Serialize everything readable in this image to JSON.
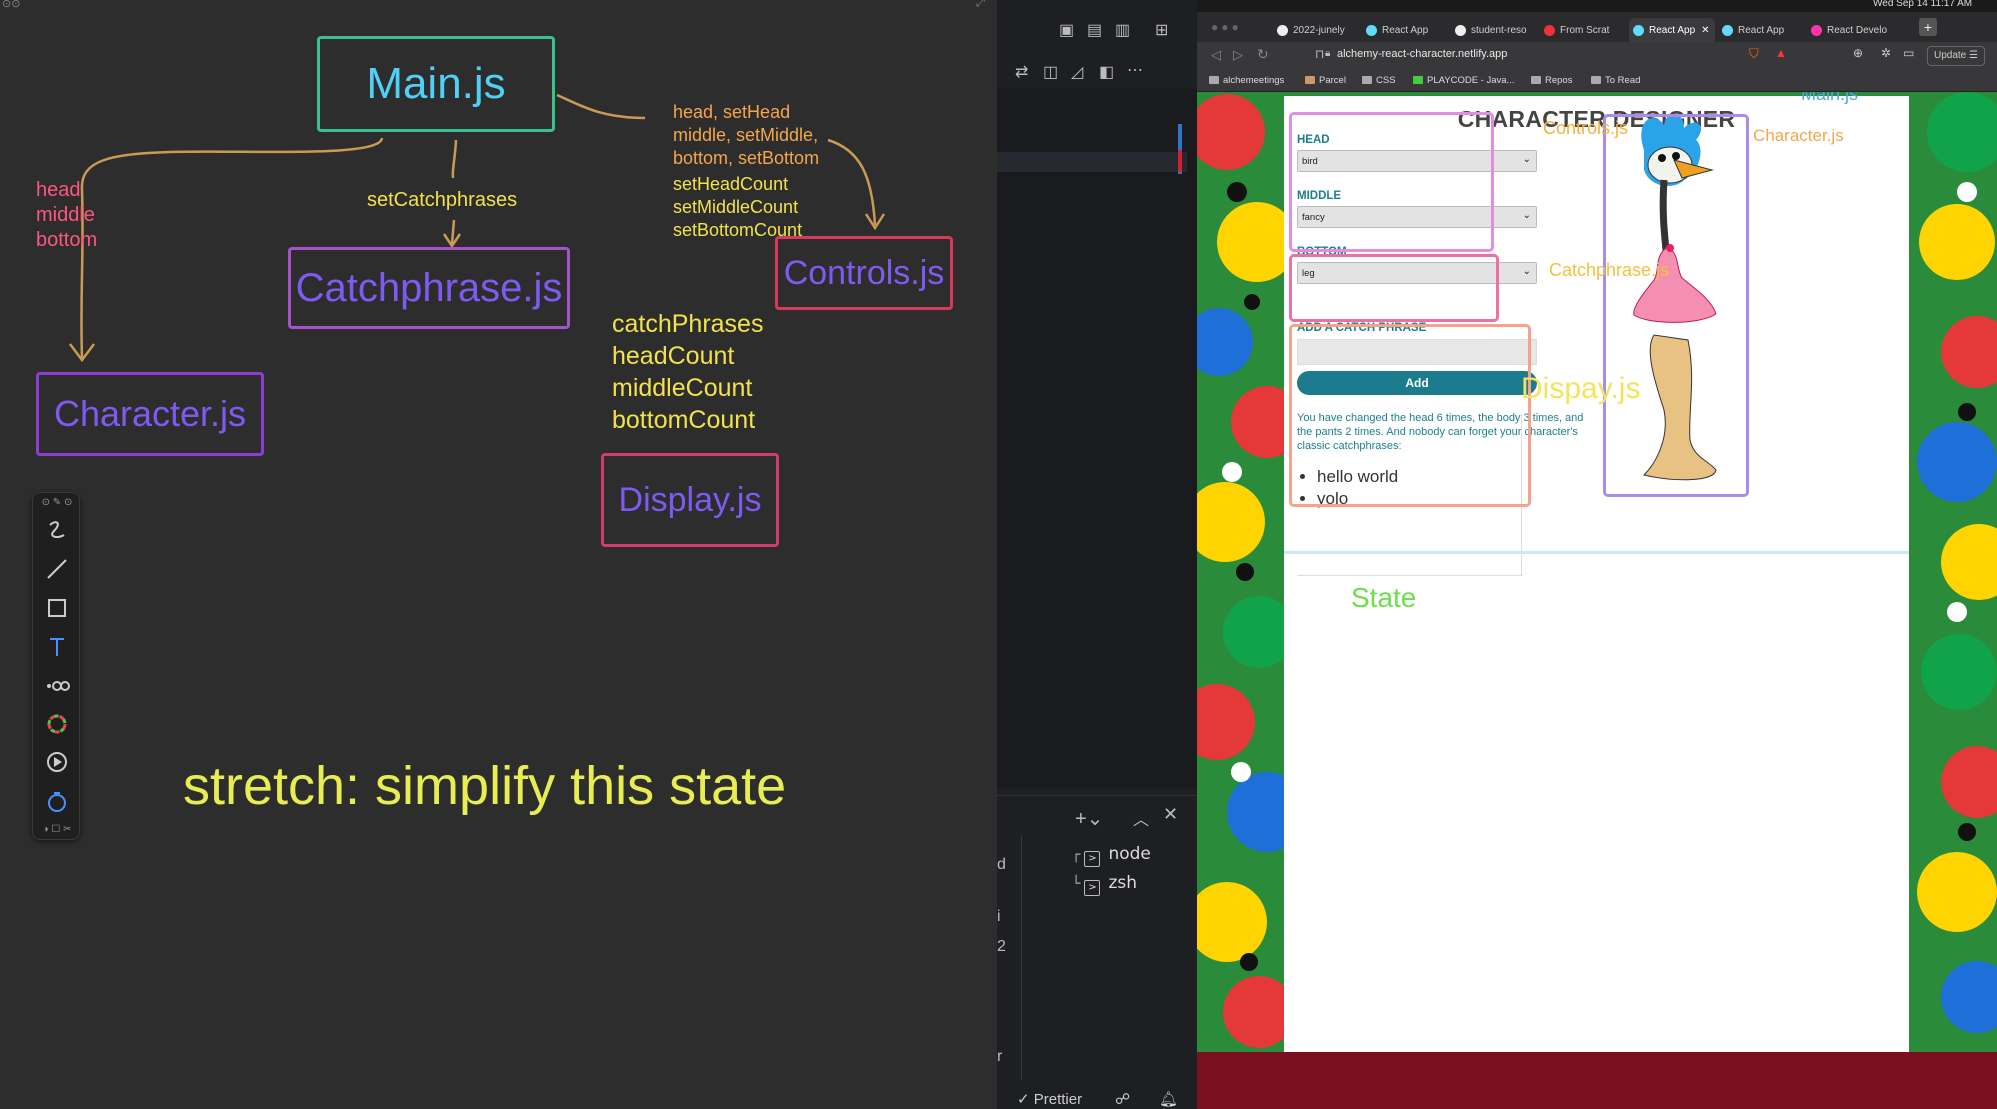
{
  "whiteboard": {
    "nodes": {
      "main": "Main.js",
      "catchphrase": "Catchphrase.js",
      "controls": "Controls.js",
      "character": "Character.js",
      "display": "Display.js"
    },
    "labels": {
      "to_character": "head\nmiddle\nbottom",
      "to_catchphrase": "setCatchphrases",
      "to_controls_1": "head, setHead\nmiddle, setMiddle,\nbottom, setBottom",
      "to_controls_2": "setHeadCount\nsetMiddleCount\nsetBottomCount",
      "to_display": "catchPhrases\nheadCount\nmiddleCount\nbottomCount",
      "stretch": "stretch: simplify this state"
    },
    "colors": {
      "main": "#39c28d",
      "catchphrase": "#a653c9",
      "controls": "#d83a5a",
      "character": "#8a3fd0",
      "display": "#d43c70",
      "node_text_main": "#4fd0f4",
      "node_text": "#7f5af0",
      "arrow": "#c99a55",
      "pink_text": "#ff5580",
      "yellow_text": "#f2e24c",
      "orange_text": "#f5a64a"
    },
    "toolbar": [
      "pen-icon",
      "line-icon",
      "rectangle-icon",
      "text-icon",
      "connector-icon",
      "color-wheel-icon",
      "play-icon",
      "timer-icon"
    ]
  },
  "vscode": {
    "terminal_items": [
      "node",
      "zsh"
    ],
    "status": "Prettier",
    "gutter_letters": [
      "d",
      "i",
      "2",
      "r"
    ]
  },
  "browser": {
    "tabs": [
      "2022-junely",
      "React App",
      "student-reso",
      "From Scrat",
      "React App",
      "React App",
      "React Develo"
    ],
    "url": "alchemy-react-character.netlify.app",
    "update_label": "Update",
    "bookmarks": [
      "alchemeetings",
      "Parcel",
      "CSS",
      "PLAYCODE - Java...",
      "Repos",
      "To Read"
    ],
    "clock": "Wed Sep 14  11:17 AM"
  },
  "app": {
    "title": "CHARACTER DESIGNER",
    "head_label": "HEAD",
    "head_value": "bird",
    "middle_label": "MIDDLE",
    "middle_value": "fancy",
    "bottom_label": "BOTTOM",
    "bottom_value": "leg",
    "catchphrase_label": "ADD A CATCH PHRASE",
    "catchphrase_value": "",
    "add_button": "Add",
    "display_text": "You have changed the head 6 times, the body 3 times, and the pants 2 times. And nobody can forget your character's classic catchphrases:",
    "catchphrases": [
      "hello world",
      "yolo"
    ]
  },
  "annotations": {
    "main": "Main.js",
    "controls": "Controls.js",
    "character": "Character.js",
    "catchphrase": "Catchphrase.js",
    "display": "Dispay.js",
    "state": "State"
  }
}
